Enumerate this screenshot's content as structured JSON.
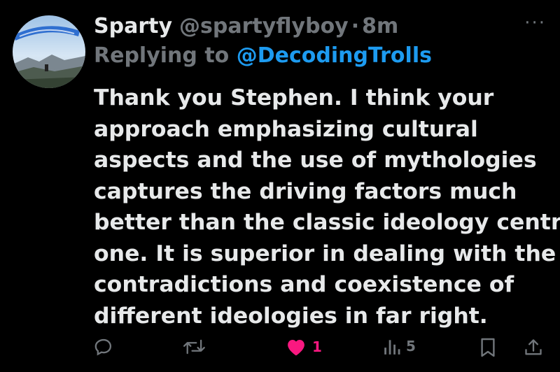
{
  "author": {
    "name": "Sparty",
    "handle": "@spartyflyboy",
    "separator": "·",
    "time": "8m",
    "more_icon": "more-horizontal-icon",
    "more_label": "···"
  },
  "reply": {
    "prefix": "Replying to",
    "handle": "@DecodingTrolls"
  },
  "tweet": {
    "lines": [
      "Thank you Stephen. I think your",
      "approach emphasizing cultural",
      "aspects and the use of mythologies",
      "captures the driving factors much",
      "better than the classic ideology centric",
      "one. It is superior in dealing with the",
      "contradictions and coexistence of",
      "different ideologies in far right."
    ]
  },
  "actions": {
    "reply": {
      "icon": "reply-icon",
      "count": ""
    },
    "retweet": {
      "icon": "retweet-icon",
      "count": ""
    },
    "like": {
      "icon": "heart-icon",
      "count": "1",
      "active": true
    },
    "views": {
      "icon": "views-icon",
      "count": "5"
    },
    "bookmark": {
      "icon": "bookmark-icon"
    },
    "share": {
      "icon": "share-icon"
    }
  },
  "colors": {
    "background": "#000000",
    "text": "#e7e9ea",
    "muted": "#71767b",
    "link": "#1d9bf0",
    "like": "#f91880"
  }
}
